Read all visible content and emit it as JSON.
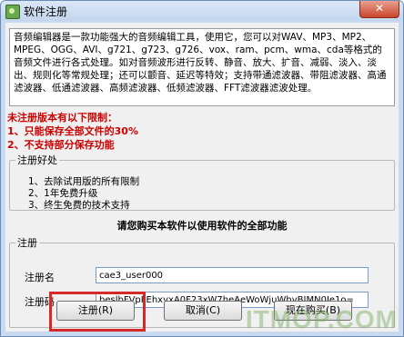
{
  "window": {
    "title": "软件注册",
    "close_label": "✕"
  },
  "description": "音频编辑器是一款功能强大的音频编辑工具，使用它，您可以对WAV、MP3、MP2、MPEG、OGG、AVI、g721、g723、g726、vox、ram、pcm、wma、cda等格式的音频文件进行各式处理。如对音频波形进行反转、静音、放大、扩音、减弱、淡入、淡出、规则化等常规处理；还可以颤音、延迟等特效；支持带通滤波器、带阻滤波器、高通滤波器、低通滤波器、高频滤波器、低频滤波器、FFT滤波器滤波处理。",
  "limits": {
    "heading": "未注册版本有以下限制：",
    "items": [
      "1、只能保存全部文件的30%",
      "2、不支持部分保存功能"
    ]
  },
  "benefits": {
    "legend": "注册好处",
    "items": [
      "1、去除试用版的所有限制",
      "2、1年免费升级",
      "3、终生免费的技术支持"
    ]
  },
  "buy_note": "请您购买本软件以使用软件的全部功能",
  "registration": {
    "legend": "注册",
    "name_label": "注册名",
    "name_value": "cae3_user000",
    "code_label": "注册码",
    "code_value": "beslbFVpFEhxvxA0F23xW7heAeWoWjuWhvBIMN0Je1o="
  },
  "buttons": {
    "register": "注册(R)",
    "cancel": "取消(C)",
    "buy_now": "现在购买(B)"
  },
  "watermark": "ITMOP.COM",
  "colors": {
    "limit_text": "#cc0000",
    "highlight_box": "#d62a2a"
  }
}
